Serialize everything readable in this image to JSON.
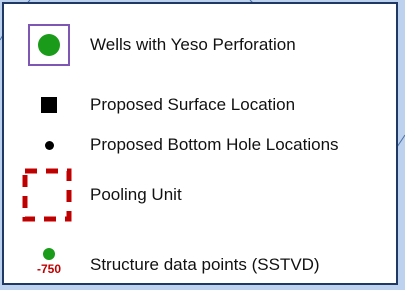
{
  "legend": {
    "items": [
      {
        "symbol": "green-circle-in-purple-square",
        "label": "Wells with Yeso Perforation",
        "color": "#1a9c1a",
        "frame_color": "#7e57b5"
      },
      {
        "symbol": "black-square",
        "label": "Proposed Surface Location",
        "color": "#000000"
      },
      {
        "symbol": "black-dot",
        "label": "Proposed Bottom Hole Locations",
        "color": "#000000"
      },
      {
        "symbol": "dashed-red-rectangle",
        "label": "Pooling Unit",
        "color": "#c00000"
      },
      {
        "symbol": "green-dot-with-value",
        "label": "Structure data points (SSTVD)",
        "value": "-750",
        "color": "#1a9c1a",
        "value_color": "#c00000"
      }
    ]
  },
  "colors": {
    "map_background": "#bcd2ee",
    "legend_border": "#1f3864",
    "map_lines": "#4a6fa5"
  }
}
